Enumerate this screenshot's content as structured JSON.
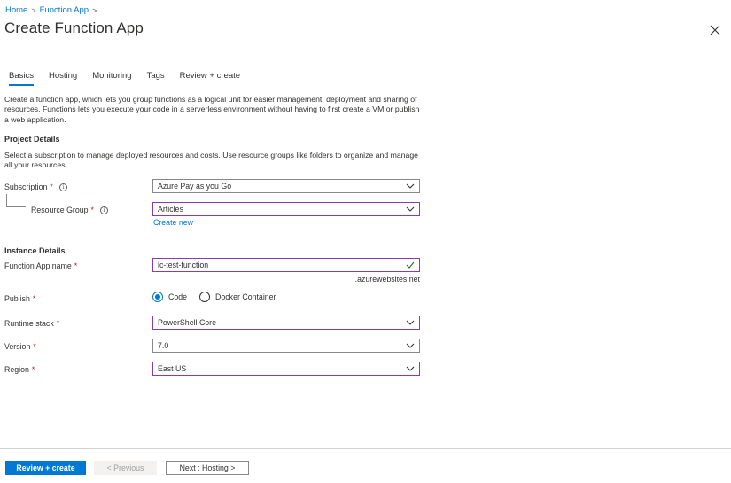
{
  "breadcrumb": {
    "home": "Home",
    "function_app": "Function App",
    "sep1": ">",
    "sep2": ">"
  },
  "page_title": "Create Function App",
  "tabs": [
    {
      "label": "Basics",
      "active": true
    },
    {
      "label": "Hosting",
      "active": false
    },
    {
      "label": "Monitoring",
      "active": false
    },
    {
      "label": "Tags",
      "active": false
    },
    {
      "label": "Review + create",
      "active": false
    }
  ],
  "intro_text": "Create a function app, which lets you group functions as a logical unit for easier management, deployment and sharing of resources. Functions lets you execute your code in a serverless environment without having to first create a VM or publish a web application.",
  "project_details": {
    "title": "Project Details",
    "desc": "Select a subscription to manage deployed resources and costs. Use resource groups like folders to organize and manage all your resources.",
    "subscription_label": "Subscription",
    "subscription_value": "Azure Pay as you Go",
    "resource_group_label": "Resource Group",
    "resource_group_value": "Articles",
    "create_new": "Create new"
  },
  "instance_details": {
    "title": "Instance Details",
    "name_label": "Function App name",
    "name_value": "lc-test-function",
    "suffix": ".azurewebsites.net",
    "publish_label": "Publish",
    "publish_options": [
      "Code",
      "Docker Container"
    ],
    "publish_selected": "Code",
    "runtime_label": "Runtime stack",
    "runtime_value": "PowerShell Core",
    "version_label": "Version",
    "version_value": "7.0",
    "region_label": "Region",
    "region_value": "East US"
  },
  "required_mark": "*",
  "info_glyph": "i",
  "footer": {
    "review_create": "Review + create",
    "previous": "< Previous",
    "next": "Next : Hosting >"
  },
  "colors": {
    "accent": "#0078d4",
    "focus_border": "#8a3ab3",
    "required": "#a4262c",
    "valid_check": "#107c10"
  },
  "icons": {
    "close": "close-icon",
    "chevron": "chevron-down-icon",
    "info": "info-icon",
    "check": "checkmark-icon"
  }
}
